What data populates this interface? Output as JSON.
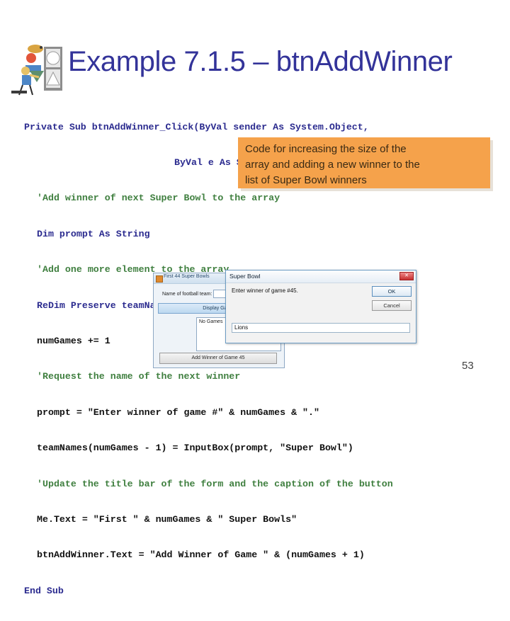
{
  "slide": {
    "title": "Example 7.1.5 – btnAddWinner",
    "page_number": "53",
    "title_color": "#333399",
    "callout_color": "#f5a24b"
  },
  "clipart": {
    "name": "person-with-shapes-clipart"
  },
  "callout": {
    "line1": "Code for increasing the size of the",
    "line2": "array and adding a new winner to the",
    "line3": "list of Super Bowl winners"
  },
  "code": {
    "l01a": "Private Sub btnAddWinner_Click(ByVal sender As System.Object,",
    "l01b": "ByVal e As System.EventArgs) Handles",
    "l02": "'Add winner of next Super Bowl to the array",
    "l03": "Dim prompt As String",
    "l04": "'Add one more element to the array",
    "l05": "ReDim Preserve teamNames(numGames)",
    "l06": "numGames += 1",
    "l07": "'Request the name of the next winner",
    "l08": "prompt = \"Enter winner of game #\" & numGames & \".\"",
    "l09": "teamNames(numGames - 1) = InputBox(prompt, \"Super Bowl\")",
    "l10": "'Update the title bar of the form and the caption of the button",
    "l11": "Me.Text = \"First \" & numGames & \" Super Bowls\"",
    "l12": "btnAddWinner.Text = \"Add Winner of Game \" & (numGames + 1)",
    "l13": "End Sub"
  },
  "screenshot": {
    "main_window": {
      "title": "First 44 Super Bowls",
      "team_label": "Name of football team:",
      "team_value": "",
      "display_button": "Display Games",
      "list_first_item": "No Games",
      "add_winner_button": "Add Winner of Game 45"
    },
    "input_dialog": {
      "title": "Super Bowl",
      "prompt": "Enter winner of game #45.",
      "ok_button": "OK",
      "cancel_button": "Cancel",
      "answer_value": "Lions",
      "close_glyph": "✕"
    }
  }
}
